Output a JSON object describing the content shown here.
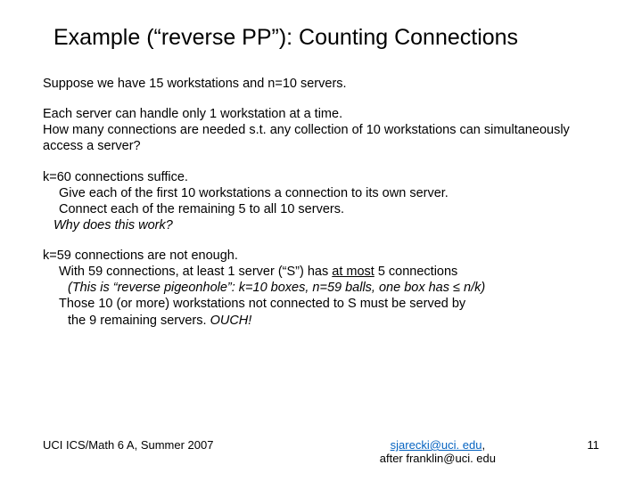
{
  "title": "Example (“reverse PP”): Counting Connections",
  "p1": "Suppose we have 15 workstations and n=10 servers.",
  "p2a": "Each server can handle only 1 workstation at a time.",
  "p2b": "How many connections are needed s.t. any collection of 10 workstations can simultaneously access a server?",
  "p3a": "k=60 connections suffice.",
  "p3b": "Give each of the first 10 workstations a connection to its own server.",
  "p3c": "Connect each of the remaining 5 to all 10 servers.",
  "p3d": "Why does this work?",
  "p4a": "k=59 connections are not enough.",
  "p4b_pre": "With 59 connections, at least 1 server (“S”) has ",
  "p4b_u": "at most",
  "p4b_post": " 5 connections",
  "p4c": "(This is “reverse pigeonhole”: k=10 boxes, n=59 balls, one box has ≤ n/k)",
  "p4d": "Those 10 (or more) workstations not connected to S must be served by",
  "p4e_pre": "the 9 remaining servers.  ",
  "p4e_italic": "OUCH!",
  "footer_left": "UCI ICS/Math 6 A, Summer 2007",
  "footer_email1": "sjarecki@uci. edu",
  "footer_email_comma": ",",
  "footer_after": "after franklin@uci. edu",
  "page_num": "11"
}
